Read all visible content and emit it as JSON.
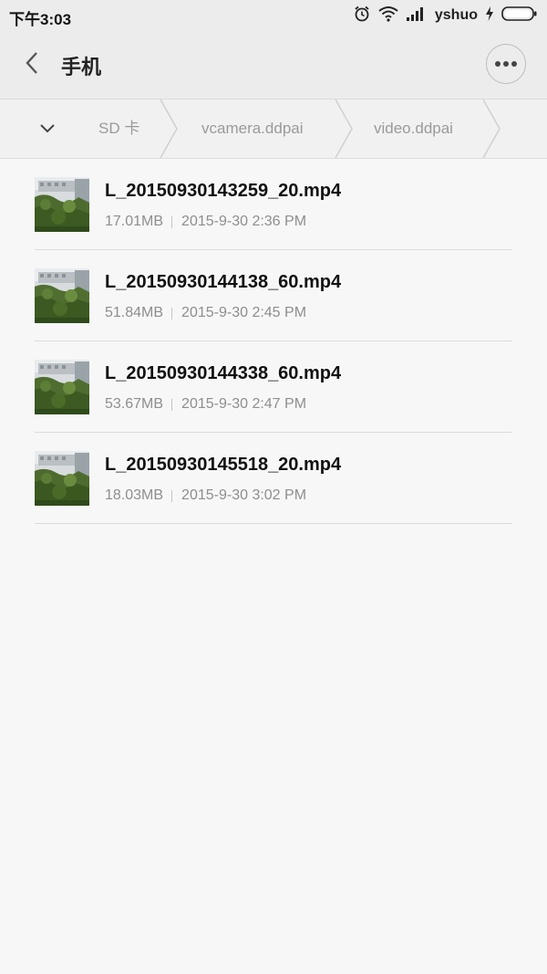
{
  "status_bar": {
    "time": "下午3:03",
    "carrier": "yshuo",
    "icons": [
      "alarm-icon",
      "wifi-icon",
      "signal-icon",
      "charging-icon",
      "battery-icon"
    ]
  },
  "app_bar": {
    "title": "手机",
    "back_icon": "chevron-left-icon",
    "more_icon": "more-dots-icon"
  },
  "breadcrumb": {
    "toggle_icon": "chevron-down-icon",
    "items": [
      {
        "label": "SD 卡"
      },
      {
        "label": "vcamera.ddpai"
      },
      {
        "label": "video.ddpai"
      }
    ]
  },
  "files": [
    {
      "name": "L_20150930143259_20.mp4",
      "size": "17.01MB",
      "date": "2015-9-30 2:36 PM"
    },
    {
      "name": "L_20150930144138_60.mp4",
      "size": "51.84MB",
      "date": "2015-9-30 2:45 PM"
    },
    {
      "name": "L_20150930144338_60.mp4",
      "size": "53.67MB",
      "date": "2015-9-30 2:47 PM"
    },
    {
      "name": "L_20150930145518_20.mp4",
      "size": "18.03MB",
      "date": "2015-9-30 3:02 PM"
    }
  ],
  "colors": {
    "bar_background": "#ececec",
    "page_background": "#f7f7f7",
    "muted_text": "#8e8e8e"
  }
}
